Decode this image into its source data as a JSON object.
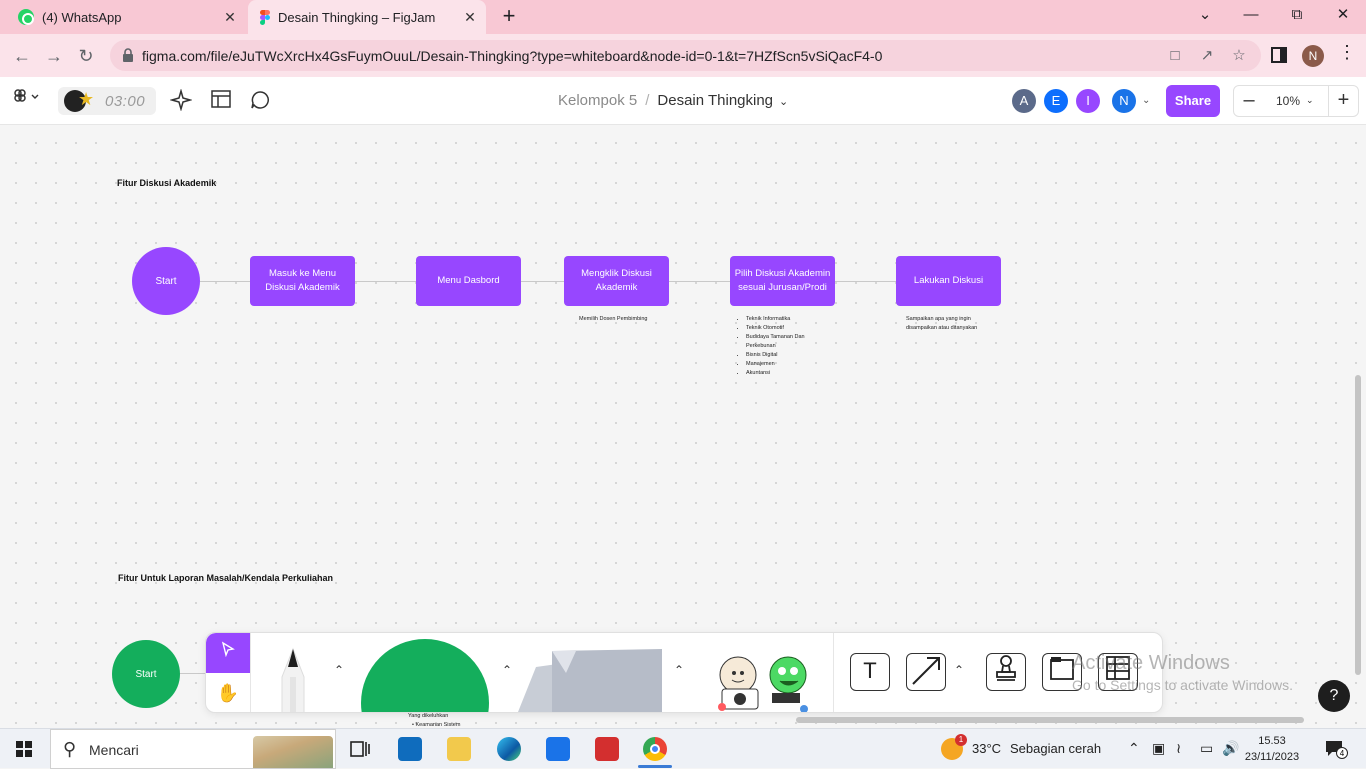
{
  "browser": {
    "tabs": [
      {
        "label": "(4) WhatsApp",
        "close": "✕"
      },
      {
        "label": "Desain Thingking – FigJam",
        "close": "✕"
      }
    ],
    "new_tab": "+",
    "url": "figma.com/file/eJuTWcXrcHx4GsFuymOuuL/Desain-Thingking?type=whiteboard&node-id=0-1&t=7HZfScn5vSiQacF4-0",
    "profile_initial": "N"
  },
  "figjam": {
    "timer": "03:00",
    "breadcrumb": {
      "team": "Kelompok 5",
      "separator": "/",
      "file": "Desain Thingking"
    },
    "collaborators": [
      {
        "initial": "A",
        "color": "#5b6a8a"
      },
      {
        "initial": "E",
        "color": "#0d6efd"
      },
      {
        "initial": "I",
        "color": "#9747ff"
      },
      {
        "initial": "N",
        "color": "#1a73e8"
      }
    ],
    "share_label": "Share",
    "zoom": "10%",
    "zoom_minus": "–",
    "zoom_plus": "+"
  },
  "canvas": {
    "section1": {
      "title": "Fitur Diskusi Akademik",
      "start": "Start",
      "steps": [
        "Masuk ke Menu Diskusi Akademik",
        "Menu Dasbord",
        "Mengklik Diskusi Akademik",
        "Pilih Diskusi Akademin sesuai Jurusan/Prodi",
        "Lakukan Diskusi"
      ],
      "note_step3": "Memilih Dosen Pembimbing",
      "note_step4": [
        "Teknik Informatika",
        "Teknik Otomotif",
        "Budidaya Tamanan Dan Perkebunan",
        "Bisnis Digital",
        "Manajemen",
        "Akuntansi"
      ],
      "note_step5": "Sampaikan apa yang ingin disampaikan atau ditanyakan"
    },
    "section2": {
      "title": "Fitur Untuk Laporan Masalah/Kendala Perkuliahan",
      "start": "Start",
      "partial_note_1": "Yang dikeluhkan",
      "partial_note_2": "Keamanan Sistem"
    }
  },
  "toolbar": {
    "text_tool": "T",
    "watermark_title": "Activate Windows",
    "watermark_sub": "Go to Settings to activate Windows.",
    "help": "?"
  },
  "taskbar": {
    "search_label": "Mencari",
    "weather_temp": "33°C",
    "weather_desc": "Sebagian cerah",
    "weather_badge": "1",
    "time": "15.53",
    "date": "23/11/2023",
    "notif_count": "4"
  }
}
